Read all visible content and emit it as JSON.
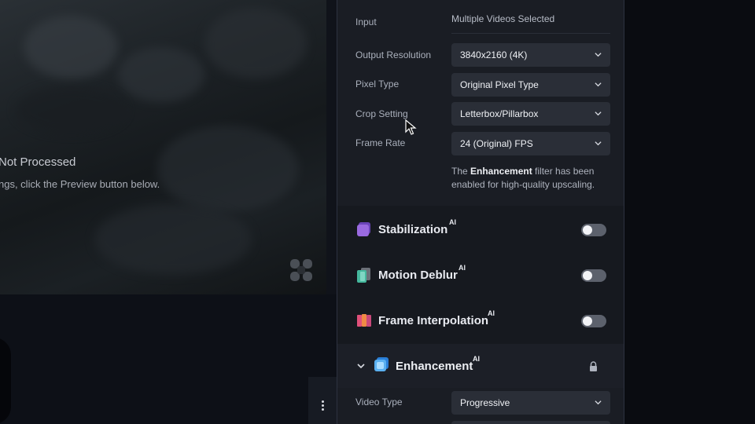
{
  "preview": {
    "status_title": "Not Processed",
    "status_hint": "ngs, click the Preview button below."
  },
  "settings": {
    "input_label": "Input",
    "input_value": "Multiple Videos Selected",
    "output_resolution_label": "Output Resolution",
    "output_resolution_value": "3840x2160 (4K)",
    "pixel_type_label": "Pixel Type",
    "pixel_type_value": "Original Pixel Type",
    "crop_setting_label": "Crop Setting",
    "crop_setting_value": "Letterbox/Pillarbox",
    "frame_rate_label": "Frame Rate",
    "frame_rate_value": "24 (Original) FPS",
    "note_prefix": "The ",
    "note_bold": "Enhancement",
    "note_suffix": " filter has been enabled for high-quality upscaling."
  },
  "features": {
    "stabilization": {
      "label": "Stabilization",
      "badge": "AI",
      "enabled": false,
      "icon": "stabilization-icon",
      "color": "#8a5cd6"
    },
    "motion_deblur": {
      "label": "Motion Deblur",
      "badge": "AI",
      "enabled": false,
      "icon": "motion-deblur-icon",
      "color": "#4fb3a3"
    },
    "frame_interpolation": {
      "label": "Frame Interpolation",
      "badge": "AI",
      "enabled": false,
      "icon": "frame-interpolation-icon",
      "color": "#e05a7a"
    }
  },
  "enhancement": {
    "label": "Enhancement",
    "badge": "AI",
    "expanded": true,
    "locked": true,
    "video_type_label": "Video Type",
    "video_type_value": "Progressive"
  }
}
